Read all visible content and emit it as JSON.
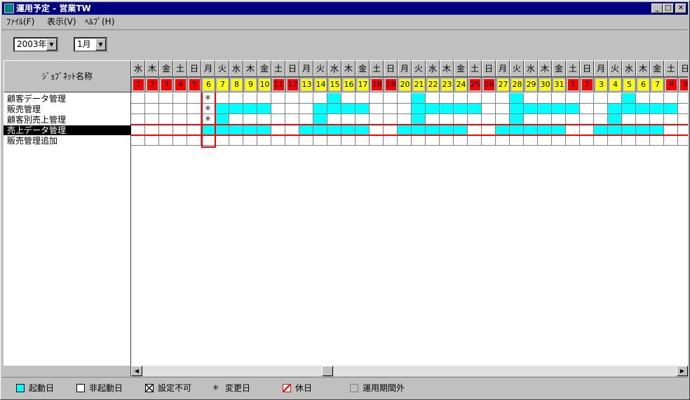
{
  "window": {
    "title": "運用予定 - 営業TW",
    "minimize": "_",
    "maximize": "□",
    "close": "✕"
  },
  "menu": [
    "ﾌｧｲﾙ(F)",
    "表示(V)",
    "ﾍﾙﾌﾟ(H)"
  ],
  "toolbar": {
    "year": "2003年",
    "month": "1月",
    "dropdown_icon": "▼"
  },
  "job_header": "ｼﾞｮﾌﾞﾈｯﾄ名称",
  "jobs": [
    {
      "name": "顧客データ管理",
      "selected": false
    },
    {
      "name": "販売管理",
      "selected": false
    },
    {
      "name": "顧客別売上管理",
      "selected": false
    },
    {
      "name": "売上データ管理",
      "selected": true
    },
    {
      "name": "販売管理追加",
      "selected": false
    }
  ],
  "calendar": {
    "weekdays": [
      "水",
      "木",
      "金",
      "土",
      "日",
      "月",
      "火",
      "水",
      "木",
      "金",
      "土",
      "日",
      "月",
      "火",
      "水",
      "木",
      "金",
      "土",
      "日",
      "月",
      "火",
      "水",
      "木",
      "金",
      "土",
      "日",
      "月",
      "火",
      "水",
      "木",
      "金",
      "土",
      "日",
      "月",
      "火",
      "水",
      "木",
      "金",
      "土",
      "日"
    ],
    "days": [
      "1",
      "2",
      "3",
      "4",
      "5",
      "6",
      "7",
      "8",
      "9",
      "10",
      "11",
      "12",
      "13",
      "14",
      "15",
      "16",
      "17",
      "18",
      "19",
      "20",
      "21",
      "22",
      "23",
      "24",
      "25",
      "26",
      "27",
      "28",
      "29",
      "30",
      "31",
      "1",
      "2",
      "3",
      "4",
      "5",
      "6",
      "7",
      "8",
      "9"
    ],
    "holiday": [
      1,
      1,
      1,
      1,
      1,
      0,
      0,
      0,
      0,
      0,
      1,
      1,
      0,
      0,
      0,
      0,
      0,
      1,
      1,
      0,
      0,
      0,
      0,
      0,
      1,
      1,
      0,
      0,
      0,
      0,
      0,
      1,
      1,
      0,
      0,
      0,
      0,
      0,
      1,
      1
    ],
    "today_column": 5,
    "rows": [
      {
        "mark": "✳",
        "on": [
          14,
          20,
          27,
          35
        ]
      },
      {
        "mark": "✳",
        "on": [
          6,
          7,
          8,
          9,
          13,
          14,
          15,
          16,
          20,
          21,
          22,
          23,
          24,
          27,
          28,
          29,
          30,
          31,
          34,
          35,
          36,
          37,
          38
        ]
      },
      {
        "mark": "✳",
        "on": [
          6,
          13,
          20,
          27,
          34
        ]
      },
      {
        "mark": "",
        "on": [
          5,
          6,
          7,
          8,
          9,
          12,
          13,
          14,
          15,
          16,
          19,
          20,
          21,
          22,
          23,
          26,
          27,
          28,
          29,
          30,
          33,
          34,
          35,
          36,
          37
        ]
      },
      {
        "mark": "",
        "on": []
      }
    ],
    "colors": {
      "start": "#00ffff",
      "holiday": "#ff0000",
      "weekday": "#ffff00",
      "select": "#ff0000"
    }
  },
  "scroll": {
    "left_icon": "◀",
    "right_icon": "▶"
  },
  "legend": [
    {
      "label": "起動日",
      "swatch": "start"
    },
    {
      "label": "非起動日",
      "swatch": "blank"
    },
    {
      "label": "設定不可",
      "swatch": "cross"
    },
    {
      "label": "変更日",
      "swatch": "star"
    },
    {
      "label": "休日",
      "swatch": "holiday"
    },
    {
      "label": "運用期間外",
      "swatch": "gray"
    }
  ]
}
